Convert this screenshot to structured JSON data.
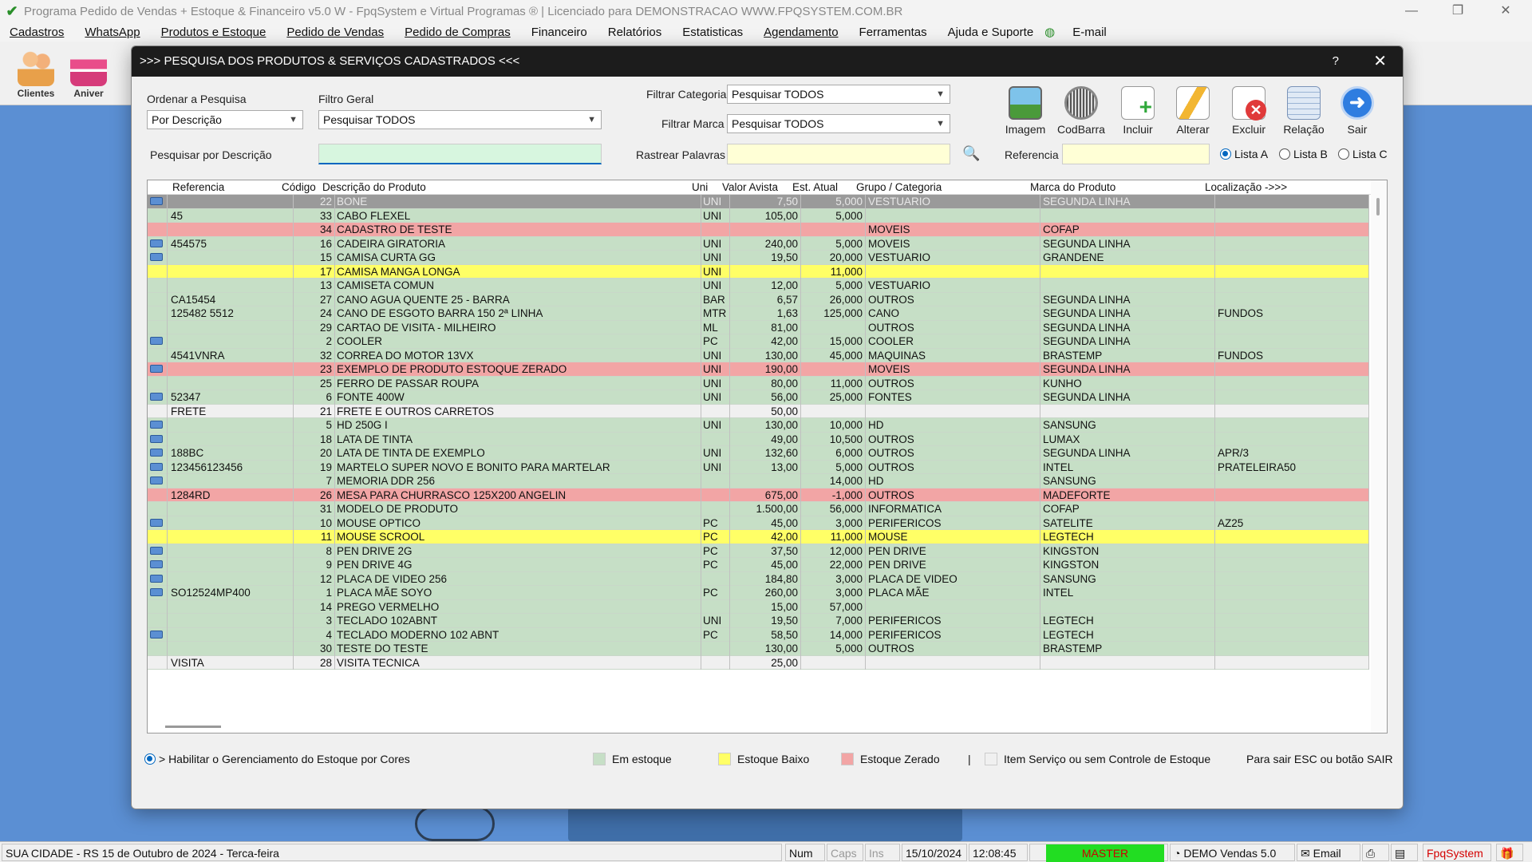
{
  "window": {
    "title": "Programa Pedido de Vendas + Estoque & Financeiro v5.0 W - FpqSystem e Virtual Programas ® | Licenciado para  DEMONSTRACAO WWW.FPQSYSTEM.COM.BR"
  },
  "menu": [
    "Cadastros",
    "WhatsApp",
    "Produtos e Estoque",
    "Pedido de Vendas",
    "Pedido de Compras",
    "Financeiro",
    "Relatórios",
    "Estatisticas",
    "Agendamento",
    "Ferramentas",
    "Ajuda e Suporte",
    "E-mail"
  ],
  "side_buttons": {
    "clientes": "Clientes",
    "aniver": "Aniver"
  },
  "dialog": {
    "title": ">>>  PESQUISA DOS PRODUTOS & SERVIÇOS CADASTRADOS  <<<",
    "help": "?",
    "close": "✕",
    "ordenar_label": "Ordenar a Pesquisa",
    "ordenar_value": "Por Descrição",
    "filtro_geral_label": "Filtro Geral",
    "filtro_geral_value": "Pesquisar TODOS",
    "filtrar_categoria_label": "Filtrar Categoria",
    "filtrar_categoria_value": "Pesquisar TODOS",
    "filtrar_marca_label": "Filtrar Marca",
    "filtrar_marca_value": "Pesquisar TODOS",
    "pesquisar_label": "Pesquisar por Descrição",
    "pesquisar_value": "",
    "rastrear_label": "Rastrear Palavras",
    "rastrear_value": "",
    "referencia_label": "Referencia",
    "referencia_value": "",
    "lists": {
      "a": "Lista A",
      "b": "Lista B",
      "c": "Lista C"
    },
    "toolbar": {
      "imagem": "Imagem",
      "codbarra": "CodBarra",
      "incluir": "Incluir",
      "alterar": "Alterar",
      "excluir": "Excluir",
      "relacao": "Relação",
      "sair": "Sair"
    }
  },
  "grid": {
    "columns": [
      "Referencia",
      "Código",
      "Descrição do Produto",
      "Uni",
      "Valor Avista",
      "Est. Atual",
      "Grupo / Categoria",
      "Marca do Produto",
      "Localização ->>>"
    ],
    "rows": [
      {
        "icon": true,
        "ref": "",
        "cod": "22",
        "desc": "BONE",
        "uni": "UNI",
        "valor": "7,50",
        "est": "5,000",
        "grupo": "VESTUARIO",
        "marca": "SEGUNDA LINHA",
        "loc": "",
        "color": "selected"
      },
      {
        "icon": false,
        "ref": "45",
        "cod": "33",
        "desc": "CABO FLEXEL",
        "uni": "UNI",
        "valor": "105,00",
        "est": "5,000",
        "grupo": "",
        "marca": "",
        "loc": "",
        "color": "green"
      },
      {
        "icon": false,
        "ref": "",
        "cod": "34",
        "desc": "CADASTRO DE TESTE",
        "uni": "",
        "valor": "",
        "est": "",
        "grupo": "MOVEIS",
        "marca": "COFAP",
        "loc": "",
        "color": "red"
      },
      {
        "icon": true,
        "ref": "454575",
        "cod": "16",
        "desc": "CADEIRA GIRATORIA",
        "uni": "UNI",
        "valor": "240,00",
        "est": "5,000",
        "grupo": "MOVEIS",
        "marca": "SEGUNDA LINHA",
        "loc": "",
        "color": "green"
      },
      {
        "icon": true,
        "ref": "",
        "cod": "15",
        "desc": "CAMISA CURTA GG",
        "uni": "UNI",
        "valor": "19,50",
        "est": "20,000",
        "grupo": "VESTUARIO",
        "marca": "GRANDENE",
        "loc": "",
        "color": "green"
      },
      {
        "icon": false,
        "ref": "",
        "cod": "17",
        "desc": "CAMISA MANGA LONGA",
        "uni": "UNI",
        "valor": "",
        "est": "11,000",
        "grupo": "",
        "marca": "",
        "loc": "",
        "color": "yellow"
      },
      {
        "icon": false,
        "ref": "",
        "cod": "13",
        "desc": "CAMISETA COMUN",
        "uni": "UNI",
        "valor": "12,00",
        "est": "5,000",
        "grupo": "VESTUARIO",
        "marca": "",
        "loc": "",
        "color": "green"
      },
      {
        "icon": false,
        "ref": "CA15454",
        "cod": "27",
        "desc": "CANO AGUA QUENTE 25 - BARRA",
        "uni": "BAR",
        "valor": "6,57",
        "est": "26,000",
        "grupo": "OUTROS",
        "marca": "SEGUNDA LINHA",
        "loc": "",
        "color": "green"
      },
      {
        "icon": false,
        "ref": "125482 5512",
        "cod": "24",
        "desc": "CANO DE ESGOTO BARRA 150 2ª LINHA",
        "uni": "MTR",
        "valor": "1,63",
        "est": "125,000",
        "grupo": "CANO",
        "marca": "SEGUNDA LINHA",
        "loc": "FUNDOS",
        "color": "green"
      },
      {
        "icon": false,
        "ref": "",
        "cod": "29",
        "desc": "CARTAO DE VISITA - MILHEIRO",
        "uni": "ML",
        "valor": "81,00",
        "est": "",
        "grupo": "OUTROS",
        "marca": "SEGUNDA LINHA",
        "loc": "",
        "color": "green"
      },
      {
        "icon": true,
        "ref": "",
        "cod": "2",
        "desc": "COOLER",
        "uni": "PC",
        "valor": "42,00",
        "est": "15,000",
        "grupo": "COOLER",
        "marca": "SEGUNDA LINHA",
        "loc": "",
        "color": "green"
      },
      {
        "icon": false,
        "ref": "4541VNRA",
        "cod": "32",
        "desc": "CORREA DO MOTOR 13VX",
        "uni": "UNI",
        "valor": "130,00",
        "est": "45,000",
        "grupo": "MAQUINAS",
        "marca": "BRASTEMP",
        "loc": "FUNDOS",
        "color": "green"
      },
      {
        "icon": true,
        "ref": "",
        "cod": "23",
        "desc": "EXEMPLO DE PRODUTO ESTOQUE ZERADO",
        "uni": "UNI",
        "valor": "190,00",
        "est": "",
        "grupo": "MOVEIS",
        "marca": "SEGUNDA LINHA",
        "loc": "",
        "color": "red"
      },
      {
        "icon": false,
        "ref": "",
        "cod": "25",
        "desc": "FERRO DE PASSAR ROUPA",
        "uni": "UNI",
        "valor": "80,00",
        "est": "11,000",
        "grupo": "OUTROS",
        "marca": "KUNHO",
        "loc": "",
        "color": "green"
      },
      {
        "icon": true,
        "ref": "52347",
        "cod": "6",
        "desc": "FONTE 400W",
        "uni": "UNI",
        "valor": "56,00",
        "est": "25,000",
        "grupo": "FONTES",
        "marca": "SEGUNDA LINHA",
        "loc": "",
        "color": "green"
      },
      {
        "icon": false,
        "ref": "FRETE",
        "cod": "21",
        "desc": "FRETE E OUTROS CARRETOS",
        "uni": "",
        "valor": "50,00",
        "est": "",
        "grupo": "",
        "marca": "",
        "loc": "",
        "color": "white"
      },
      {
        "icon": true,
        "ref": "",
        "cod": "5",
        "desc": "HD 250G   I",
        "uni": "UNI",
        "valor": "130,00",
        "est": "10,000",
        "grupo": "HD",
        "marca": "SANSUNG",
        "loc": "",
        "color": "green"
      },
      {
        "icon": true,
        "ref": "",
        "cod": "18",
        "desc": "LATA DE TINTA",
        "uni": "",
        "valor": "49,00",
        "est": "10,500",
        "grupo": "OUTROS",
        "marca": "LUMAX",
        "loc": "",
        "color": "green"
      },
      {
        "icon": true,
        "ref": "188BC",
        "cod": "20",
        "desc": "LATA DE TINTA DE EXEMPLO",
        "uni": "UNI",
        "valor": "132,60",
        "est": "6,000",
        "grupo": "OUTROS",
        "marca": "SEGUNDA LINHA",
        "loc": "APR/3",
        "color": "green"
      },
      {
        "icon": true,
        "ref": "123456123456",
        "cod": "19",
        "desc": "MARTELO SUPER NOVO E BONITO PARA MARTELAR",
        "uni": "UNI",
        "valor": "13,00",
        "est": "5,000",
        "grupo": "OUTROS",
        "marca": "INTEL",
        "loc": "PRATELEIRA50",
        "color": "green"
      },
      {
        "icon": true,
        "ref": "",
        "cod": "7",
        "desc": "MEMORIA DDR 256",
        "uni": "",
        "valor": "",
        "est": "14,000",
        "grupo": "HD",
        "marca": "SANSUNG",
        "loc": "",
        "color": "green"
      },
      {
        "icon": false,
        "ref": "1284RD",
        "cod": "26",
        "desc": "MESA PARA CHURRASCO 125X200 ANGELIN",
        "uni": "",
        "valor": "675,00",
        "est": "-1,000",
        "grupo": "OUTROS",
        "marca": "MADEFORTE",
        "loc": "",
        "color": "red"
      },
      {
        "icon": false,
        "ref": "",
        "cod": "31",
        "desc": "MODELO DE PRODUTO",
        "uni": "",
        "valor": "1.500,00",
        "est": "56,000",
        "grupo": "INFORMATICA",
        "marca": "COFAP",
        "loc": "",
        "color": "green"
      },
      {
        "icon": true,
        "ref": "",
        "cod": "10",
        "desc": "MOUSE OPTICO",
        "uni": "PC",
        "valor": "45,00",
        "est": "3,000",
        "grupo": "PERIFERICOS",
        "marca": "SATELITE",
        "loc": "AZ25",
        "color": "green"
      },
      {
        "icon": false,
        "ref": "",
        "cod": "11",
        "desc": "MOUSE SCROOL",
        "uni": "PC",
        "valor": "42,00",
        "est": "11,000",
        "grupo": "MOUSE",
        "marca": "LEGTECH",
        "loc": "",
        "color": "yellow"
      },
      {
        "icon": true,
        "ref": "",
        "cod": "8",
        "desc": "PEN DRIVE 2G",
        "uni": "PC",
        "valor": "37,50",
        "est": "12,000",
        "grupo": "PEN DRIVE",
        "marca": "KINGSTON",
        "loc": "",
        "color": "green"
      },
      {
        "icon": true,
        "ref": "",
        "cod": "9",
        "desc": "PEN DRIVE 4G",
        "uni": "PC",
        "valor": "45,00",
        "est": "22,000",
        "grupo": "PEN DRIVE",
        "marca": "KINGSTON",
        "loc": "",
        "color": "green"
      },
      {
        "icon": true,
        "ref": "",
        "cod": "12",
        "desc": "PLACA DE VIDEO 256",
        "uni": "",
        "valor": "184,80",
        "est": "3,000",
        "grupo": "PLACA DE VIDEO",
        "marca": "SANSUNG",
        "loc": "",
        "color": "green"
      },
      {
        "icon": true,
        "ref": "SO12524MP400",
        "cod": "1",
        "desc": "PLACA MÃE SOYO",
        "uni": "PC",
        "valor": "260,00",
        "est": "3,000",
        "grupo": "PLACA MÃE",
        "marca": "INTEL",
        "loc": "",
        "color": "green"
      },
      {
        "icon": false,
        "ref": "",
        "cod": "14",
        "desc": "PREGO VERMELHO",
        "uni": "",
        "valor": "15,00",
        "est": "57,000",
        "grupo": "",
        "marca": "",
        "loc": "",
        "color": "green"
      },
      {
        "icon": false,
        "ref": "",
        "cod": "3",
        "desc": "TECLADO 102ABNT",
        "uni": "UNI",
        "valor": "19,50",
        "est": "7,000",
        "grupo": "PERIFERICOS",
        "marca": "LEGTECH",
        "loc": "",
        "color": "green"
      },
      {
        "icon": true,
        "ref": "",
        "cod": "4",
        "desc": "TECLADO MODERNO 102 ABNT",
        "uni": "PC",
        "valor": "58,50",
        "est": "14,000",
        "grupo": "PERIFERICOS",
        "marca": "LEGTECH",
        "loc": "",
        "color": "green"
      },
      {
        "icon": false,
        "ref": "",
        "cod": "30",
        "desc": "TESTE DO TESTE",
        "uni": "",
        "valor": "130,00",
        "est": "5,000",
        "grupo": "OUTROS",
        "marca": "BRASTEMP",
        "loc": "",
        "color": "green"
      },
      {
        "icon": false,
        "ref": "VISITA",
        "cod": "28",
        "desc": "VISITA TECNICA",
        "uni": "",
        "valor": "25,00",
        "est": "",
        "grupo": "",
        "marca": "",
        "loc": "",
        "color": "white"
      }
    ]
  },
  "legend": {
    "habilitar": "> Habilitar o Gerenciamento do Estoque por Cores",
    "em_estoque": "Em estoque",
    "estoque_baixo": "Estoque Baixo",
    "estoque_zerado": "Estoque Zerado",
    "separator": "|",
    "item_servico": "Item Serviço ou sem Controle de Estoque",
    "hint": "Para sair ESC ou botão SAIR"
  },
  "colors": {
    "green": "#c6dfc6",
    "yellow": "#ffff66",
    "red": "#f2a5a5",
    "white": "#f0f0f0",
    "selected": "#9a9a9a",
    "accent": "#0067c0"
  },
  "statusbar": {
    "city": "SUA CIDADE - RS 15 de Outubro de 2024 - Terca-feira",
    "num": "Num",
    "caps": "Caps",
    "ins": "Ins",
    "date": "15/10/2024",
    "time": "12:08:45",
    "master": "MASTER",
    "demo": "DEMO Vendas 5.0",
    "email": "Email",
    "brand": "FpqSystem"
  }
}
